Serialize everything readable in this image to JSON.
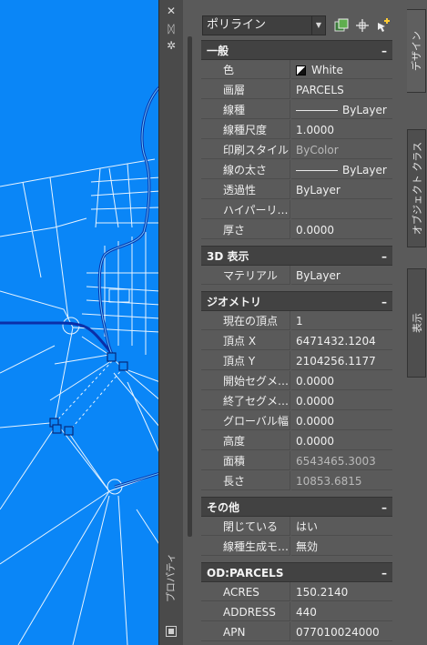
{
  "palette": {
    "title": "プロパティ",
    "close_glyph": "✕",
    "autohide_glyph": "ᛞ",
    "settings_glyph": "✲"
  },
  "object_type": "ポリライン",
  "categories": [
    {
      "name": "一般",
      "rows": [
        {
          "label": "色",
          "value": "White"
        },
        {
          "label": "画層",
          "value": "PARCELS"
        },
        {
          "label": "線種",
          "value": "ByLayer"
        },
        {
          "label": "線種尺度",
          "value": "1.0000"
        },
        {
          "label": "印刷スタイル",
          "value": "ByColor"
        },
        {
          "label": "線の太さ",
          "value": "ByLayer"
        },
        {
          "label": "透過性",
          "value": "ByLayer"
        },
        {
          "label": "ハイパーリ…",
          "value": ""
        },
        {
          "label": "厚さ",
          "value": "0.0000"
        }
      ]
    },
    {
      "name": "3D 表示",
      "rows": [
        {
          "label": "マテリアル",
          "value": "ByLayer"
        }
      ]
    },
    {
      "name": "ジオメトリ",
      "rows": [
        {
          "label": "現在の頂点",
          "value": "1"
        },
        {
          "label": "頂点 X",
          "value": "6471432.1204"
        },
        {
          "label": "頂点 Y",
          "value": "2104256.1177"
        },
        {
          "label": "開始セグメ…",
          "value": "0.0000"
        },
        {
          "label": "終了セグメ…",
          "value": "0.0000"
        },
        {
          "label": "グローバル幅",
          "value": "0.0000"
        },
        {
          "label": "高度",
          "value": "0.0000"
        },
        {
          "label": "面積",
          "value": "6543465.3003"
        },
        {
          "label": "長さ",
          "value": "10853.6815"
        }
      ]
    },
    {
      "name": "その他",
      "rows": [
        {
          "label": "閉じている",
          "value": "はい"
        },
        {
          "label": "線種生成モ…",
          "value": "無効"
        }
      ]
    },
    {
      "name": "OD:PARCELS",
      "rows": [
        {
          "label": "ACRES",
          "value": "150.2140"
        },
        {
          "label": "ADDRESS",
          "value": "440"
        },
        {
          "label": "APN",
          "value": "077010024000"
        }
      ]
    }
  ],
  "tabs": {
    "design": "デザイン",
    "object_class": "オブジェクト クラス",
    "display": "表示"
  },
  "collapse_glyph": "–",
  "colors": {
    "map_background": "#0a86f7",
    "road": "#0b2fa8",
    "parcel_lines": "#ffffff"
  }
}
